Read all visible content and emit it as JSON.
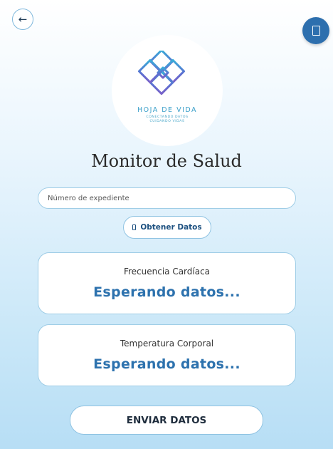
{
  "nav": {
    "back_symbol": "←",
    "corner_icon": "device-icon"
  },
  "logo": {
    "title": "HOJA DE VIDA",
    "line1": "CONECTANDO DATOS",
    "line2": "CUIDANDO VIDAS",
    "colors": [
      "#3aaed8",
      "#5b6fd1",
      "#7a62c9"
    ]
  },
  "page": {
    "title": "Monitor de Salud"
  },
  "search": {
    "placeholder": "Número de expediente",
    "value": ""
  },
  "get_data_button": {
    "label": "Obtener Datos",
    "icon": "phone-icon"
  },
  "cards": [
    {
      "label": "Frecuencia Cardíaca",
      "value": "Esperando datos..."
    },
    {
      "label": "Temperatura Corporal",
      "value": "Esperando datos..."
    }
  ],
  "send_button": {
    "label": "ENVIAR DATOS"
  },
  "colors": {
    "accent": "#2d72ae",
    "border": "#9fcde6",
    "bg_top": "#ffffff",
    "bg_bottom": "#b7def5"
  }
}
